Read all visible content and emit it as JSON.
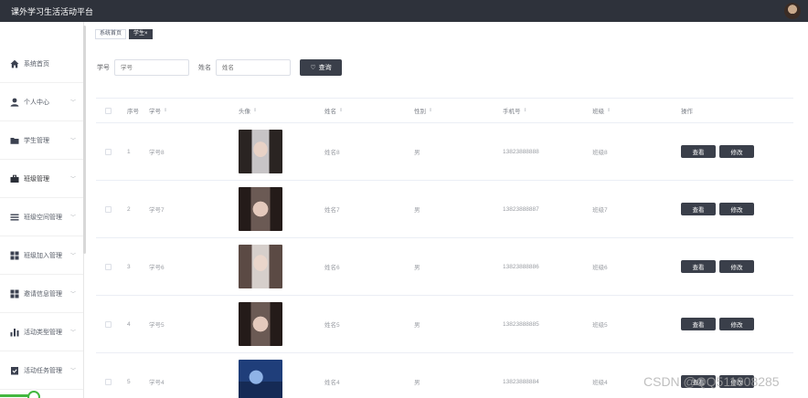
{
  "app": {
    "title": "课外学习生活活动平台"
  },
  "sidebar": {
    "items": [
      {
        "label": "系统首页",
        "icon": "home-icon",
        "has_chevron": false
      },
      {
        "label": "个人中心",
        "icon": "user-icon",
        "has_chevron": true
      },
      {
        "label": "学生管理",
        "icon": "folder-icon",
        "has_chevron": true
      },
      {
        "label": "班级管理",
        "icon": "briefcase-icon",
        "has_chevron": true
      },
      {
        "label": "班级空间管理",
        "icon": "list-icon",
        "has_chevron": true
      },
      {
        "label": "班级加入管理",
        "icon": "grid-icon",
        "has_chevron": true
      },
      {
        "label": "邀请信息管理",
        "icon": "grid-icon",
        "has_chevron": true
      },
      {
        "label": "活动类型管理",
        "icon": "bar-chart-icon",
        "has_chevron": true
      },
      {
        "label": "活动任务管理",
        "icon": "clipboard-icon",
        "has_chevron": true
      }
    ]
  },
  "tabs": [
    {
      "label": "系统首页",
      "active": false
    },
    {
      "label": "学生",
      "active": true,
      "close": "×"
    }
  ],
  "search": {
    "student_no_label": "学号",
    "student_no_placeholder": "学号",
    "name_label": "姓名",
    "name_placeholder": "姓名",
    "query_button": "查询",
    "query_icon": "heart-icon"
  },
  "table": {
    "headers": {
      "index": "序号",
      "student_no": "学号",
      "photo": "头像",
      "name": "姓名",
      "gender": "性别",
      "phone": "手机号",
      "class": "班级",
      "ops": "操作"
    },
    "sort_glyph": "⇕",
    "rows": [
      {
        "index": "1",
        "student_no": "学号8",
        "name": "姓名8",
        "gender": "男",
        "phone": "13823888888",
        "class": "班级8"
      },
      {
        "index": "2",
        "student_no": "学号7",
        "name": "姓名7",
        "gender": "男",
        "phone": "13823888887",
        "class": "班级7"
      },
      {
        "index": "3",
        "student_no": "学号6",
        "name": "姓名6",
        "gender": "男",
        "phone": "13823888886",
        "class": "班级6"
      },
      {
        "index": "4",
        "student_no": "学号5",
        "name": "姓名5",
        "gender": "男",
        "phone": "13823888885",
        "class": "班级5"
      },
      {
        "index": "5",
        "student_no": "学号4",
        "name": "姓名4",
        "gender": "男",
        "phone": "13823888884",
        "class": "班级4"
      }
    ],
    "view_button": "查看",
    "edit_button": "修改"
  },
  "watermark": "CSDN @QQ511008285"
}
